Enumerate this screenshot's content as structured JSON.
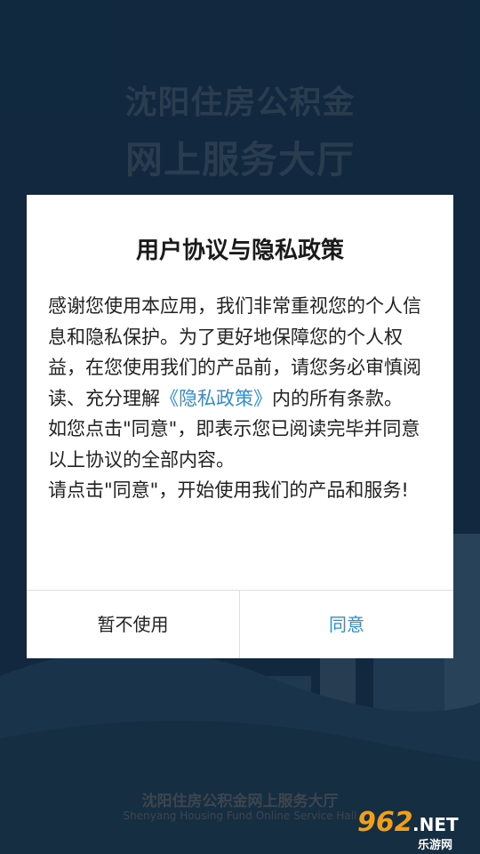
{
  "splash": {
    "title_line1": "沈阳住房公积金",
    "title_line2": "网上服务大厅",
    "footer_cn": "沈阳住房公积金网上服务大厅",
    "footer_en": "Shenyang Housing Fund Online Service Hall"
  },
  "dialog": {
    "title": "用户协议与隐私政策",
    "body_part1": "感谢您使用本应用，我们非常重视您的个人信息和隐私保护。为了更好地保障您的个人权益，在您使用我们的产品前，请您务必审慎阅读、充分理解",
    "policy_link": "《隐私政策》",
    "body_part2": "内的所有条款。",
    "body_para2": "如您点击\"同意\"，即表示您已阅读完毕并同意以上协议的全部内容。",
    "body_para3": "请点击\"同意\"，开始使用我们的产品和服务!",
    "decline_label": "暂不使用",
    "agree_label": "同意"
  },
  "watermark": {
    "number": "962",
    "suffix": ".NET",
    "sub": "乐游网"
  },
  "colors": {
    "background": "#1f4a72",
    "link": "#2b8fd6",
    "watermark_orange": "#f0a018"
  }
}
